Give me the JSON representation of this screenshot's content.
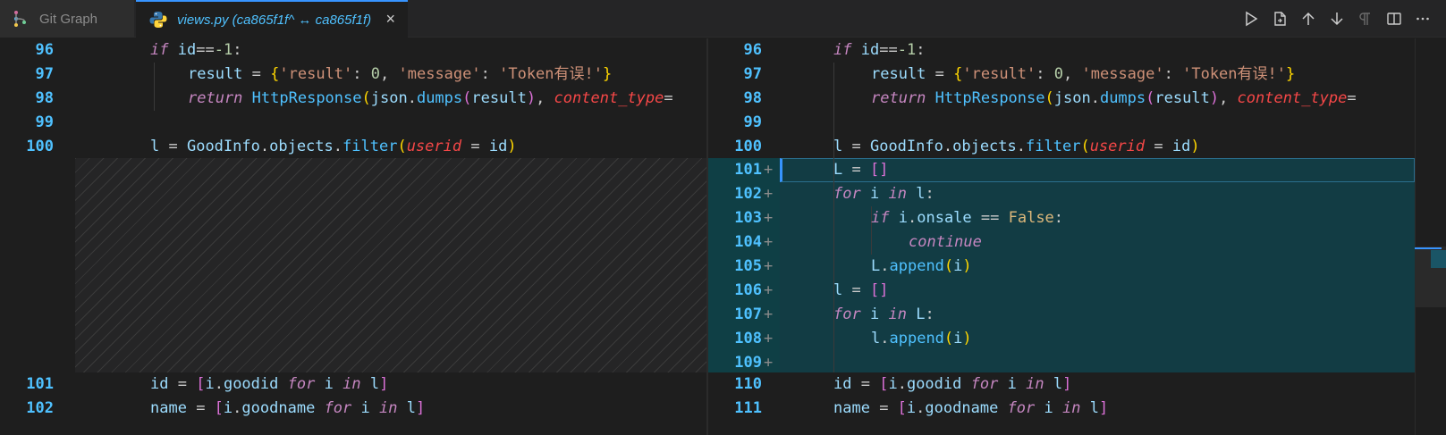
{
  "tabs": {
    "git_graph": "Git Graph",
    "views": "views.py (ca865f1f^ ↔ ca865f1f)",
    "close": "×"
  },
  "actions": [
    "run-icon",
    "open-file-icon",
    "arrow-up-icon",
    "arrow-down-icon",
    "pilcrow-icon",
    "split-editor-icon",
    "more-icon"
  ],
  "left": {
    "lines": [
      {
        "n": "96",
        "code": "if id==-1:"
      },
      {
        "n": "97",
        "code": "    result = {'result': 0, 'message': 'Token有误!'}"
      },
      {
        "n": "98",
        "code": "    return HttpResponse(json.dumps(result), content_type="
      },
      {
        "n": "99",
        "code": ""
      },
      {
        "n": "100",
        "code": "l = GoodInfo.objects.filter(userid = id)"
      },
      {
        "n": "101",
        "code": "id = [i.goodid for i in l]"
      },
      {
        "n": "102",
        "code": "name = [i.goodname for i in l]"
      }
    ]
  },
  "right": {
    "lines": [
      {
        "n": "96",
        "code": "if id==-1:"
      },
      {
        "n": "97",
        "code": "    result = {'result': 0, 'message': 'Token有误!'}"
      },
      {
        "n": "98",
        "code": "    return HttpResponse(json.dumps(result), content_type="
      },
      {
        "n": "99",
        "code": ""
      },
      {
        "n": "100",
        "code": "l = GoodInfo.objects.filter(userid = id)"
      },
      {
        "n": "101",
        "code": "L = []",
        "added": "+"
      },
      {
        "n": "102",
        "code": "for i in l:",
        "added": "+"
      },
      {
        "n": "103",
        "code": "    if i.onsale == False:",
        "added": "+"
      },
      {
        "n": "104",
        "code": "        continue",
        "added": "+"
      },
      {
        "n": "105",
        "code": "    L.append(i)",
        "added": "+"
      },
      {
        "n": "106",
        "code": "l = []",
        "added": "+"
      },
      {
        "n": "107",
        "code": "for i in L:",
        "added": "+"
      },
      {
        "n": "108",
        "code": "    l.append(i)",
        "added": "+"
      },
      {
        "n": "109",
        "code": "",
        "added": "+"
      },
      {
        "n": "110",
        "code": "id = [i.goodid for i in l]"
      },
      {
        "n": "111",
        "code": "name = [i.goodname for i in l]"
      }
    ]
  },
  "colors": {
    "line_number": "#4fc1ff",
    "keyword": "#c586c0",
    "function": "#4fc1ff",
    "string": "#ce9178",
    "inserted_bg": "#123c44"
  }
}
